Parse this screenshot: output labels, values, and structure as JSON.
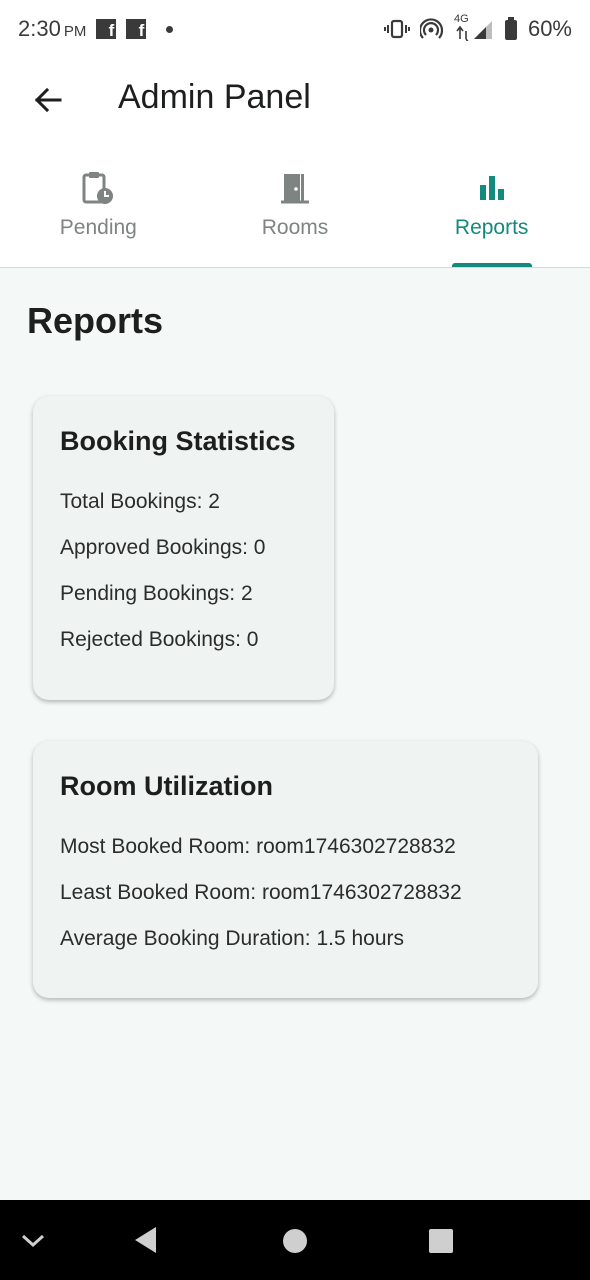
{
  "status_bar": {
    "time": "2:30",
    "ampm": "PM",
    "network": "4G",
    "battery": "60%"
  },
  "app_bar": {
    "title": "Admin Panel"
  },
  "tabs": [
    {
      "label": "Pending",
      "icon": "clipboard-clock-icon",
      "active": false
    },
    {
      "label": "Rooms",
      "icon": "door-icon",
      "active": false
    },
    {
      "label": "Reports",
      "icon": "bar-chart-icon",
      "active": true
    }
  ],
  "page": {
    "title": "Reports"
  },
  "booking_stats": {
    "title": "Booking Statistics",
    "total": "Total Bookings: 2",
    "approved": "Approved Bookings: 0",
    "pending": "Pending Bookings: 2",
    "rejected": "Rejected Bookings: 0"
  },
  "room_utilization": {
    "title": "Room Utilization",
    "most_booked": "Most Booked Room: room1746302728832",
    "least_booked": "Least Booked Room: room1746302728832",
    "avg_duration": "Average Booking Duration: 1.5 hours"
  },
  "colors": {
    "accent": "#138a7c",
    "background": "#f4f9f7",
    "card": "#eff4f2"
  }
}
